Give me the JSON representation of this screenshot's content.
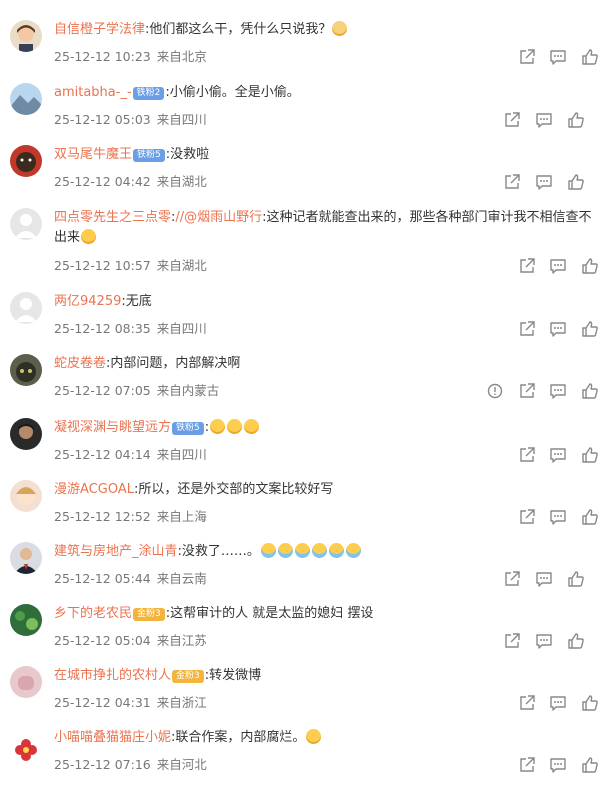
{
  "comments": [
    {
      "user": "自信橙子学法律",
      "badge": "",
      "badge_color": "",
      "mention": "",
      "text": ":他们都这么干，凭什么只说我？",
      "emoji_count": 1,
      "emoji_kind": "cat",
      "time": "25-12-12 10:23",
      "location": "来自北京",
      "avatar": "cartoon-girl",
      "report": false
    },
    {
      "user": "amitabha-_-",
      "badge": "铁粉2",
      "badge_color": "blue",
      "mention": "",
      "text": ":小偷小偷。全是小偷。",
      "emoji_count": 0,
      "emoji_kind": "",
      "time": "25-12-12 05:03",
      "location": "来自四川",
      "avatar": "mountain",
      "report": false
    },
    {
      "user": "双马尾牛魔王",
      "badge": "铁粉5",
      "badge_color": "blue",
      "mention": "",
      "text": ":没救啦",
      "emoji_count": 0,
      "emoji_kind": "",
      "time": "25-12-12 04:42",
      "location": "来自湖北",
      "avatar": "bear",
      "report": false
    },
    {
      "user": "四点零先生之三点零",
      "badge": "",
      "badge_color": "",
      "mention": "//@烟雨山野行",
      "text": ":这种记者就能查出来的，那些各种部门审计我不相信查不出来",
      "emoji_count": 1,
      "emoji_kind": "face",
      "time": "25-12-12 10:57",
      "location": "来自湖北",
      "avatar": "default",
      "report": false
    },
    {
      "user": "两亿94259",
      "badge": "",
      "badge_color": "",
      "mention": "",
      "text": ":无底",
      "emoji_count": 0,
      "emoji_kind": "",
      "time": "25-12-12 08:35",
      "location": "来自四川",
      "avatar": "default",
      "report": false
    },
    {
      "user": "蛇皮卷卷",
      "badge": "",
      "badge_color": "",
      "mention": "",
      "text": ":内部问题，内部解决啊",
      "emoji_count": 0,
      "emoji_kind": "",
      "time": "25-12-12 07:05",
      "location": "来自内蒙古",
      "avatar": "dark-cat",
      "report": true
    },
    {
      "user": "凝视深渊与眺望远方",
      "badge": "铁粉5",
      "badge_color": "blue",
      "mention": "",
      "text": ":",
      "emoji_count": 3,
      "emoji_kind": "face",
      "time": "25-12-12 04:14",
      "location": "来自四川",
      "avatar": "man-dark",
      "report": false
    },
    {
      "user": "漫游ACGOAL",
      "badge": "",
      "badge_color": "",
      "mention": "",
      "text": ":所以，还是外交部的文案比较好写",
      "emoji_count": 0,
      "emoji_kind": "",
      "time": "25-12-12 12:52",
      "location": "来自上海",
      "avatar": "anime",
      "report": false
    },
    {
      "user": "建筑与房地产_涂山青",
      "badge": "",
      "badge_color": "",
      "mention": "",
      "text": ":没救了……。",
      "emoji_count": 6,
      "emoji_kind": "cry",
      "time": "25-12-12 05:44",
      "location": "来自云南",
      "avatar": "suit-man",
      "report": false
    },
    {
      "user": "乡下的老农民",
      "badge": "金粉3",
      "badge_color": "gold",
      "mention": "",
      "text": ":这帮审计的人 就是太监的媳妇    摆设",
      "emoji_count": 0,
      "emoji_kind": "",
      "time": "25-12-12 05:04",
      "location": "来自江苏",
      "avatar": "green",
      "report": false
    },
    {
      "user": "在城市挣扎的农村人",
      "badge": "金粉3",
      "badge_color": "gold",
      "mention": "",
      "text": ":转发微博",
      "emoji_count": 0,
      "emoji_kind": "",
      "time": "25-12-12 04:31",
      "location": "来自浙江",
      "avatar": "pink-hand",
      "report": false
    },
    {
      "user": "小喵喵叠猫猫庄小妮",
      "badge": "",
      "badge_color": "",
      "mention": "",
      "text": ":联合作案，内部腐烂。",
      "emoji_count": 1,
      "emoji_kind": "face",
      "time": "25-12-12 07:16",
      "location": "来自河北",
      "avatar": "flower",
      "report": false
    }
  ],
  "colors": {
    "username": "#eb7350",
    "meta": "#777777",
    "icon": "#888888"
  },
  "icons": [
    "share-icon",
    "comment-icon",
    "like-icon",
    "report-icon"
  ]
}
